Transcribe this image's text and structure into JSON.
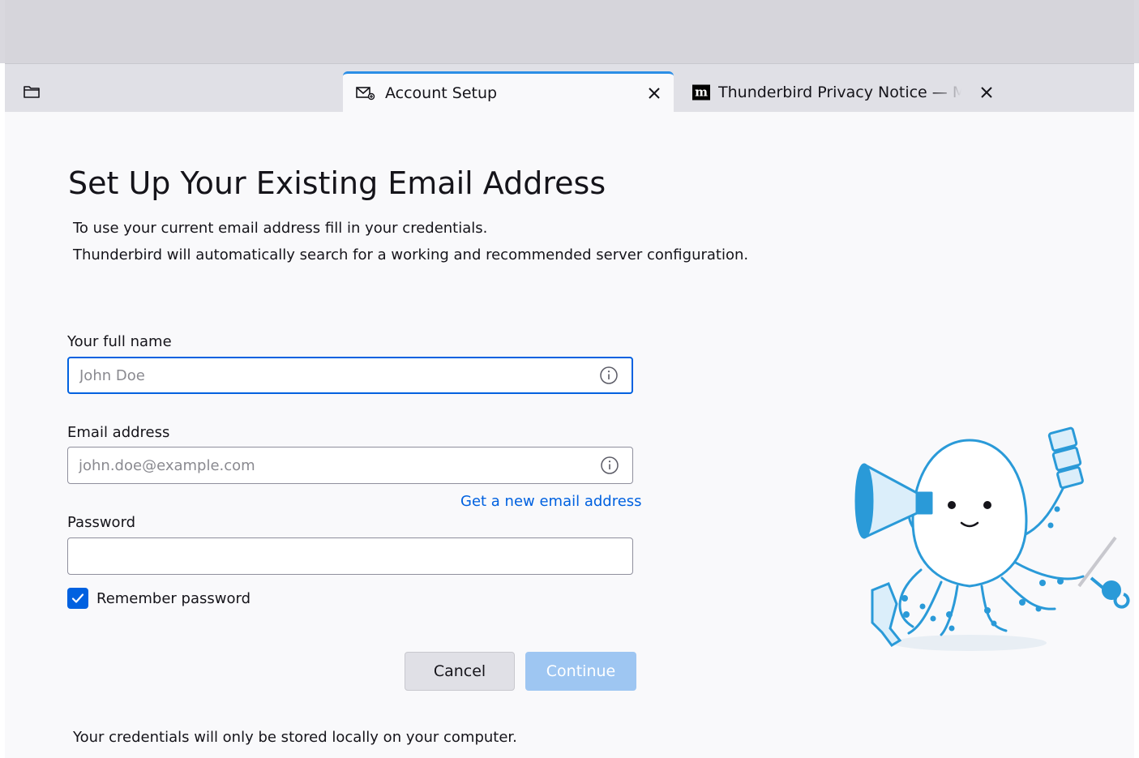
{
  "tabs": [
    {
      "label": "Account Setup",
      "icon": "envelope-setup-icon",
      "active": true
    },
    {
      "label": "Thunderbird Privacy Notice — Mozilla",
      "icon": "mozilla-m-icon",
      "logo_text": "m",
      "active": false
    }
  ],
  "page": {
    "heading": "Set Up Your Existing Email Address",
    "intro_line1": "To use your current email address fill in your credentials.",
    "intro_line2": "Thunderbird will automatically search for a working and recommended server configuration."
  },
  "form": {
    "full_name": {
      "label": "Your full name",
      "placeholder": "John Doe",
      "value": ""
    },
    "email": {
      "label": "Email address",
      "placeholder": "john.doe@example.com",
      "value": ""
    },
    "new_email_link": "Get a new email address",
    "password": {
      "label": "Password",
      "value": ""
    },
    "remember_password": {
      "label": "Remember password",
      "checked": true
    }
  },
  "buttons": {
    "cancel": "Cancel",
    "continue": "Continue"
  },
  "footer": {
    "note": "Your credentials will only be stored locally on your computer."
  },
  "colors": {
    "accent": "#0061e0",
    "tab_indicator": "#2b8ee6",
    "continue_disabled": "#9ec6f2",
    "mascot_blue": "#2a9ad8",
    "mascot_light": "#dbeefa"
  }
}
